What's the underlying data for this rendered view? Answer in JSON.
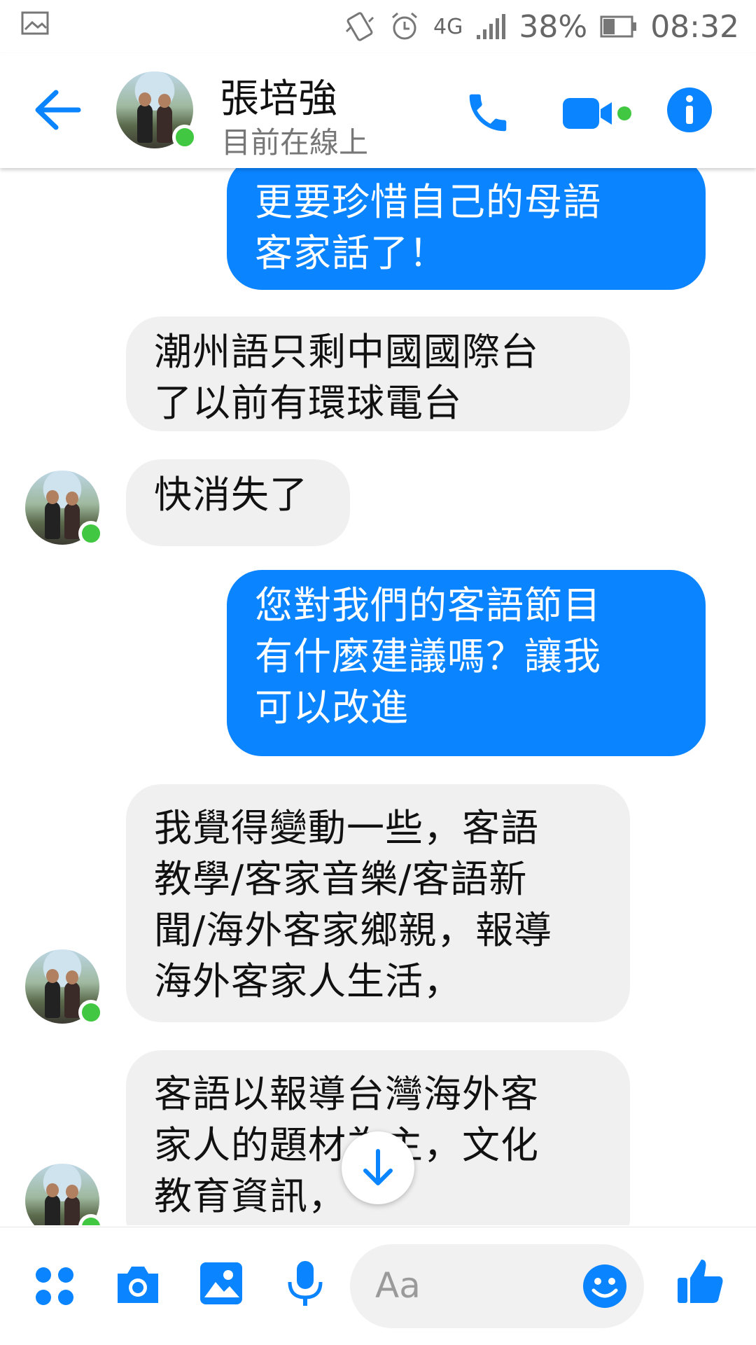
{
  "status_bar": {
    "battery": "38%",
    "time": "08:32",
    "network": "4G"
  },
  "header": {
    "contact_name": "張培強",
    "presence": "目前在線上"
  },
  "colors": {
    "accent": "#0a84ff",
    "online": "#42c742",
    "incoming_bubble": "#f1f0f0"
  },
  "messages": [
    {
      "from": "me",
      "text": "更要珍惜自己的母語\n客家話了！"
    },
    {
      "from": "them",
      "text": "潮州語只剩中國國際台\n了以前有環球電台"
    },
    {
      "from": "them",
      "text": "快消失了"
    },
    {
      "from": "me",
      "text": "您對我們的客語節目\n有什麼建議嗎？讓我\n可以改進"
    },
    {
      "from": "them",
      "text": "我覺得變動一些，客語\n教學/客家音樂/客語新\n聞/海外客家鄉親，報導\n海外客家人生活，"
    },
    {
      "from": "them",
      "text": "客語以報導台灣海外客\n家人的題材為主，文化\n教育資訊，"
    }
  ],
  "composer": {
    "placeholder": "Aa"
  },
  "icons": [
    "back-arrow-icon",
    "phone-icon",
    "video-camera-icon",
    "info-icon",
    "apps-grid-icon",
    "camera-icon",
    "gallery-icon",
    "microphone-icon",
    "emoji-icon",
    "thumbs-up-icon",
    "arrow-down-icon"
  ]
}
